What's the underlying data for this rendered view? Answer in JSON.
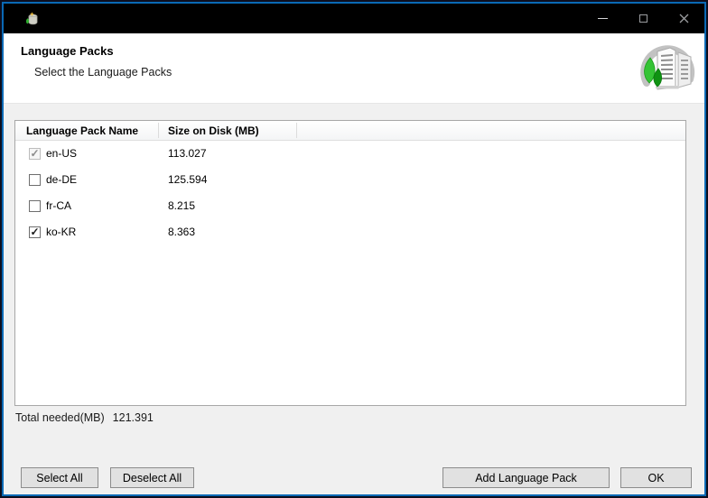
{
  "titlebar": {
    "controls": {
      "minimize": "minimize",
      "maximize": "maximize",
      "close": "close"
    }
  },
  "header": {
    "title": "Language Packs",
    "subtitle": "Select the Language Packs"
  },
  "table": {
    "columns": [
      {
        "label": "Language Pack Name"
      },
      {
        "label": "Size on Disk (MB)"
      }
    ],
    "rows": [
      {
        "name": "en-US",
        "size_mb": "113.027",
        "checked": true,
        "disabled": true
      },
      {
        "name": "de-DE",
        "size_mb": "125.594",
        "checked": false,
        "disabled": false
      },
      {
        "name": "fr-CA",
        "size_mb": "8.215",
        "checked": false,
        "disabled": false
      },
      {
        "name": "ko-KR",
        "size_mb": "8.363",
        "checked": true,
        "disabled": false
      }
    ]
  },
  "total": {
    "label": "Total needed(MB)",
    "value": "121.391"
  },
  "buttons": {
    "select_all": "Select All",
    "deselect_all": "Deselect All",
    "add_language_pack": "Add Language Pack",
    "ok": "OK"
  },
  "icons": {
    "check_glyph": "✓"
  },
  "colors": {
    "titlebar_bg": "#000000",
    "window_border_outer": "#0c0e1e",
    "window_border_accent": "#0a69b5",
    "body_bg": "#f0f0f0",
    "table_border": "#a7a7a7",
    "button_bg": "#e1e1e1",
    "button_border": "#8c8c8c",
    "tree_green_light": "#35c435",
    "tree_green_dark": "#0f9212",
    "disabled_check": "#8b8b8b"
  }
}
